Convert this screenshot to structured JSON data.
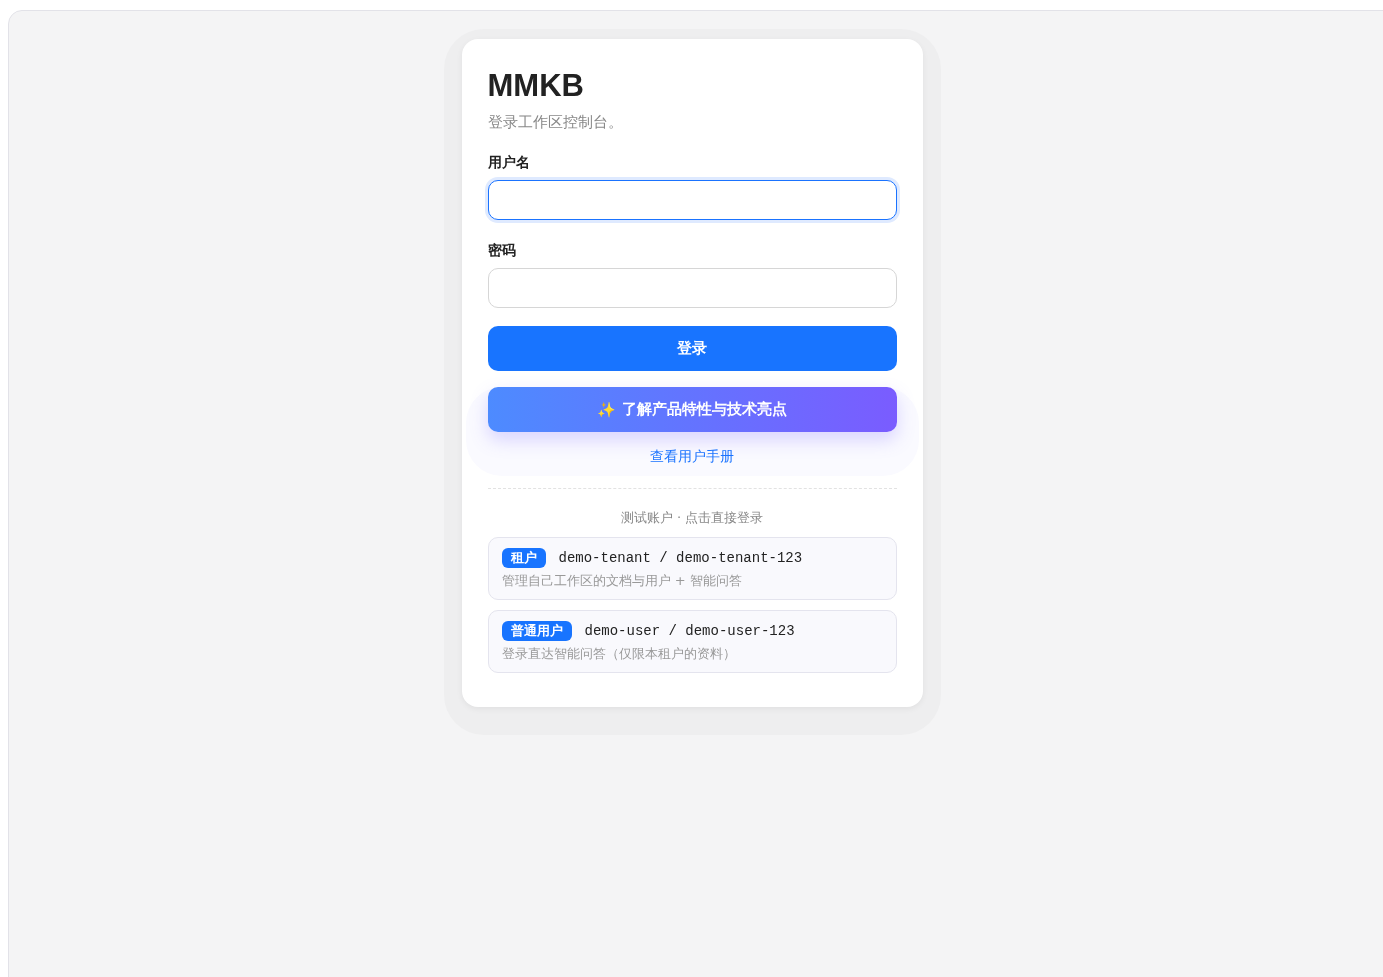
{
  "brand": "MMKB",
  "subtitle": "登录工作区控制台。",
  "fields": [
    {
      "label": "用户名",
      "focused": true
    },
    {
      "label": "密码",
      "focused": false
    }
  ],
  "login_button": "登录",
  "features_button": {
    "icon": "✨",
    "label": "了解产品特性与技术亮点"
  },
  "manual_link": "查看用户手册",
  "demo_heading": "测试账户 · 点击直接登录",
  "demo_accounts": [
    {
      "role": "租户",
      "credentials": "demo-tenant / demo-tenant-123",
      "description": "管理自己工作区的文档与用户 + 智能问答"
    },
    {
      "role": "普通用户",
      "credentials": "demo-user / demo-user-123",
      "description": "登录直达智能问答（仅限本租户的资料）"
    }
  ]
}
